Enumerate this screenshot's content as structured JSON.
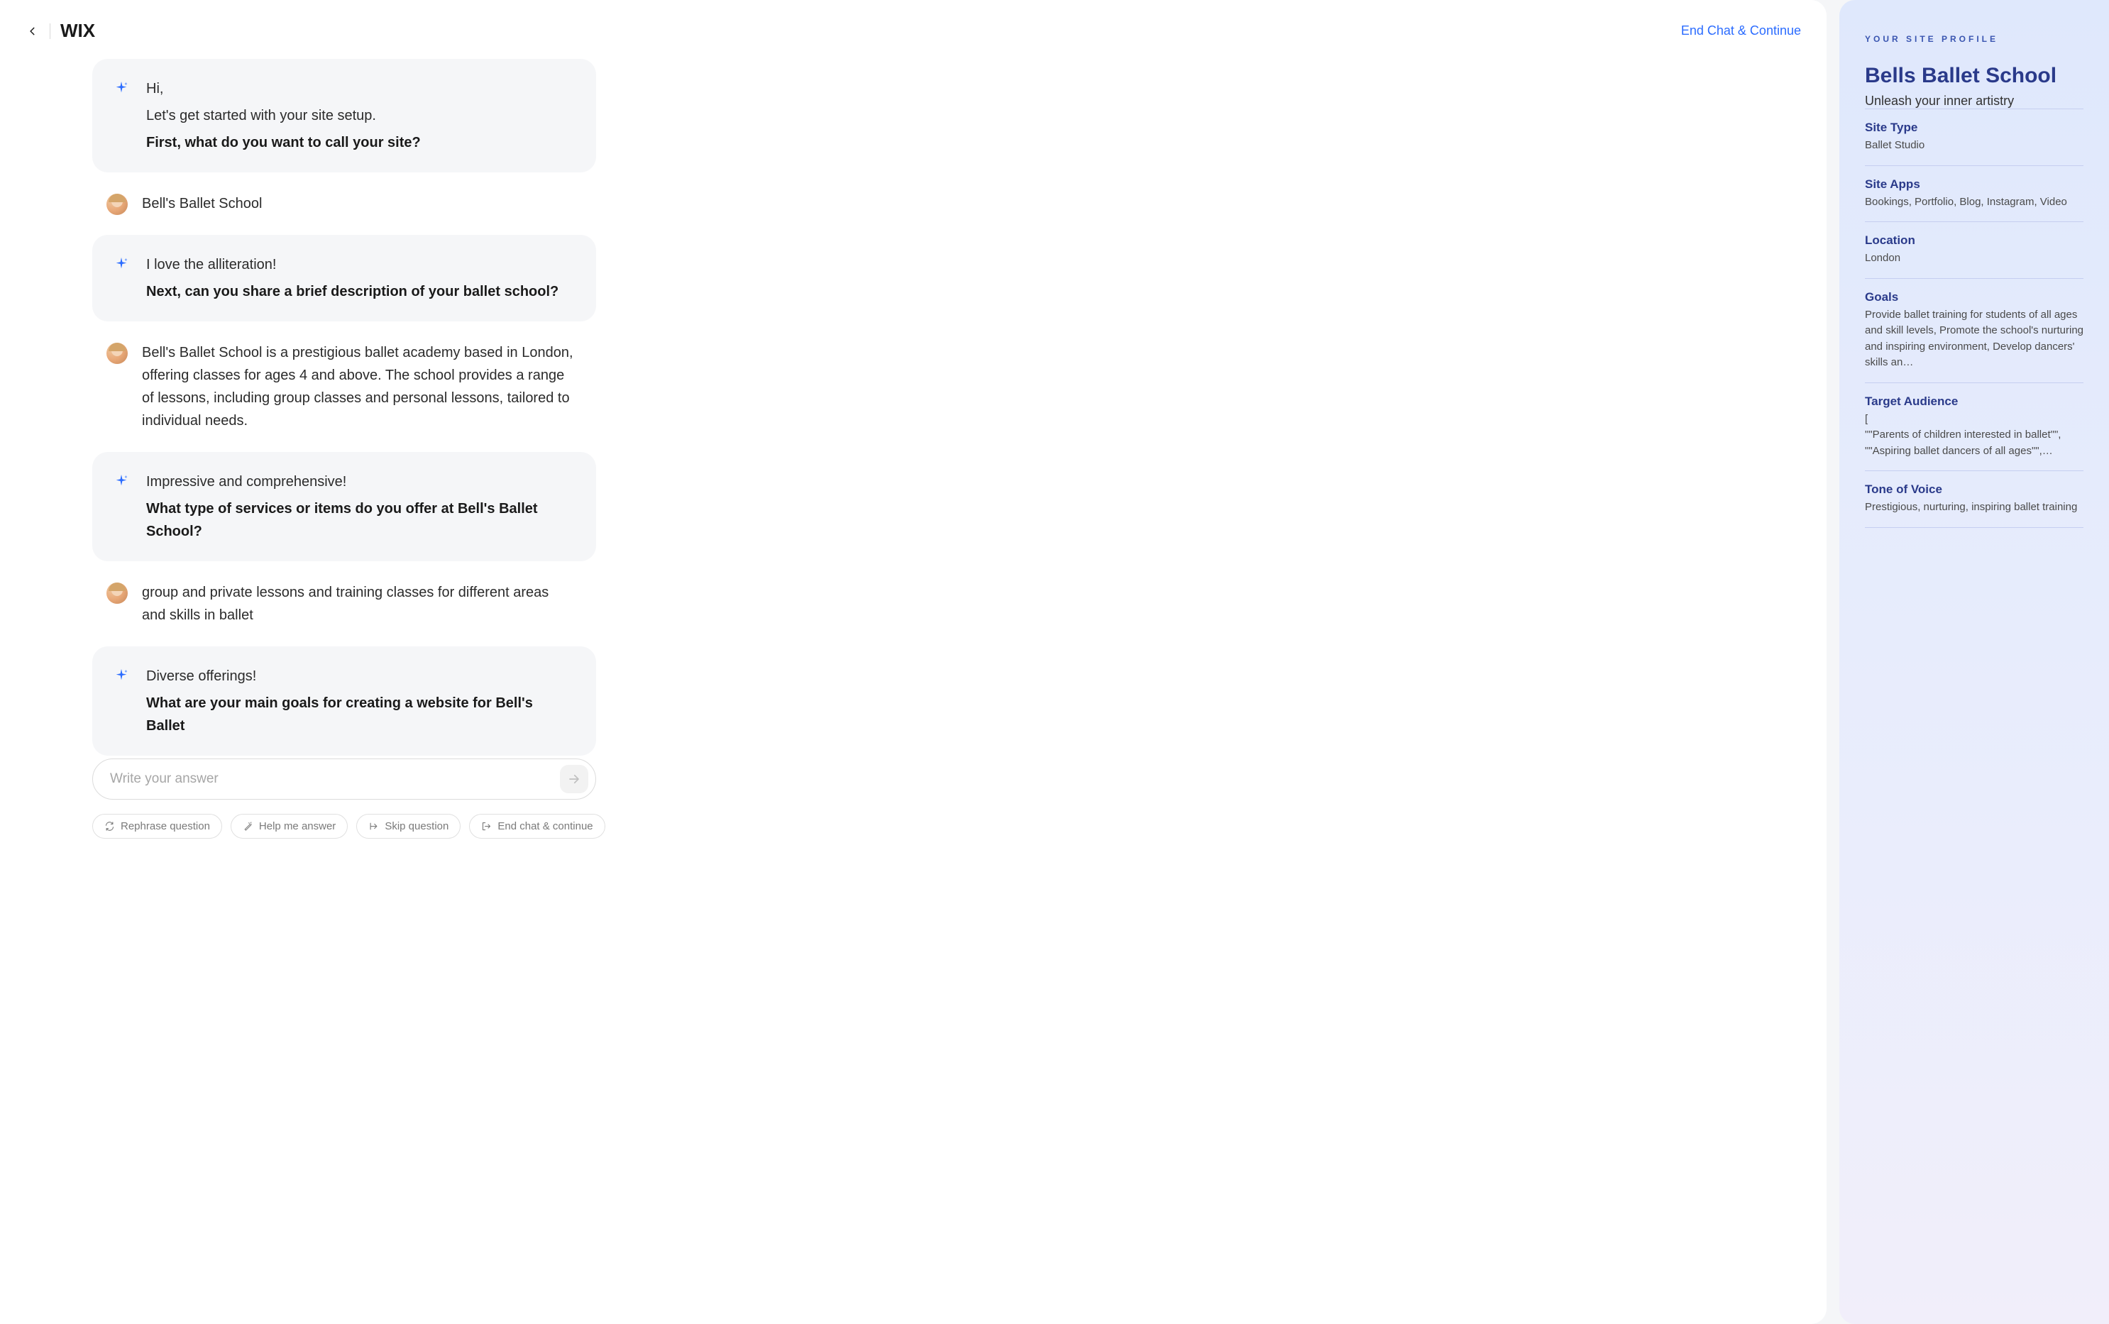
{
  "header": {
    "end_chat": "End Chat & Continue"
  },
  "chat": {
    "messages": [
      {
        "role": "ai",
        "lines": [
          {
            "text": "Hi,",
            "bold": false
          },
          {
            "text": "Let's get started with your site setup.",
            "bold": false
          },
          {
            "text": "First, what do you want to call your site?",
            "bold": true
          }
        ]
      },
      {
        "role": "user",
        "lines": [
          {
            "text": "Bell's Ballet School",
            "bold": false
          }
        ]
      },
      {
        "role": "ai",
        "lines": [
          {
            "text": "I love the alliteration!",
            "bold": false
          },
          {
            "text": "Next, can you share a brief description of your ballet school?",
            "bold": true
          }
        ]
      },
      {
        "role": "user",
        "lines": [
          {
            "text": "Bell's Ballet School is a prestigious ballet academy based in London, offering classes for ages 4 and above. The school provides a range of lessons, including group classes and personal lessons, tailored to individual needs.",
            "bold": false
          }
        ]
      },
      {
        "role": "ai",
        "lines": [
          {
            "text": "Impressive and comprehensive!",
            "bold": false
          },
          {
            "text": "What type of services or items do you offer at Bell's Ballet School?",
            "bold": true
          }
        ]
      },
      {
        "role": "user",
        "lines": [
          {
            "text": "group and private lessons and training classes for different areas and skills in ballet",
            "bold": false
          }
        ]
      },
      {
        "role": "ai",
        "lines": [
          {
            "text": "Diverse offerings!",
            "bold": false
          },
          {
            "text": "What are your main goals for creating a website for Bell's Ballet",
            "bold": true
          }
        ]
      }
    ],
    "input_placeholder": "Write your answer",
    "actions": {
      "rephrase": "Rephrase question",
      "help": "Help me answer",
      "skip": "Skip question",
      "end": "End chat & continue"
    }
  },
  "profile": {
    "eyebrow": "YOUR SITE PROFILE",
    "title": "Bells Ballet School",
    "tagline": "Unleash your inner artistry",
    "sections": {
      "site_type": {
        "label": "Site Type",
        "value": "Ballet Studio"
      },
      "site_apps": {
        "label": "Site Apps",
        "value": "Bookings, Portfolio, Blog, Instagram, Video"
      },
      "location": {
        "label": "Location",
        "value": "London"
      },
      "goals": {
        "label": "Goals",
        "value": "Provide ballet training for students of all ages and skill levels, Promote the school's nurturing and inspiring environment, Develop dancers' skills an"
      },
      "target_audience": {
        "label": "Target Audience",
        "value": "[\n\"\"Parents of children interested in ballet\"\",\n\"\"Aspiring ballet dancers of all ages\"\","
      },
      "tone": {
        "label": "Tone of Voice",
        "value": "Prestigious, nurturing, inspiring ballet training"
      }
    }
  }
}
